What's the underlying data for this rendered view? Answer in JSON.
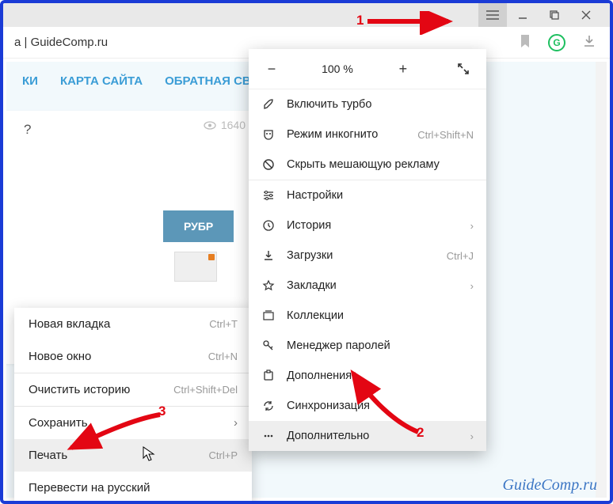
{
  "page": {
    "title": "a | GuideComp.ru",
    "nav": [
      "КИ",
      "КАРТА САЙТА",
      "ОБРАТНАЯ СВЯ"
    ],
    "question": "?",
    "views": "1640",
    "rubrik": "РУБР"
  },
  "titlebar": {
    "hamburger": "≡"
  },
  "zoom": {
    "minus": "−",
    "value": "100 %",
    "plus": "+"
  },
  "mainmenu": {
    "turbo": "Включить турбо",
    "incognito": "Режим инкогнито",
    "incognito_sc": "Ctrl+Shift+N",
    "hide_ads": "Скрыть мешающую рекламу",
    "settings": "Настройки",
    "history": "История",
    "downloads": "Загрузки",
    "downloads_sc": "Ctrl+J",
    "bookmarks": "Закладки",
    "collections": "Коллекции",
    "passwords": "Менеджер паролей",
    "addons": "Дополнения",
    "sync": "Синхронизация",
    "more": "Дополнительно"
  },
  "submenu": {
    "new_tab": "Новая вкладка",
    "new_tab_sc": "Ctrl+T",
    "new_window": "Новое окно",
    "new_window_sc": "Ctrl+N",
    "clear_history": "Очистить историю",
    "clear_history_sc": "Ctrl+Shift+Del",
    "save": "Сохранить",
    "print": "Печать",
    "print_sc": "Ctrl+P",
    "translate": "Перевести на русский"
  },
  "annotations": {
    "n1": "1",
    "n2": "2",
    "n3": "3"
  },
  "watermark": "GuideComp.ru"
}
